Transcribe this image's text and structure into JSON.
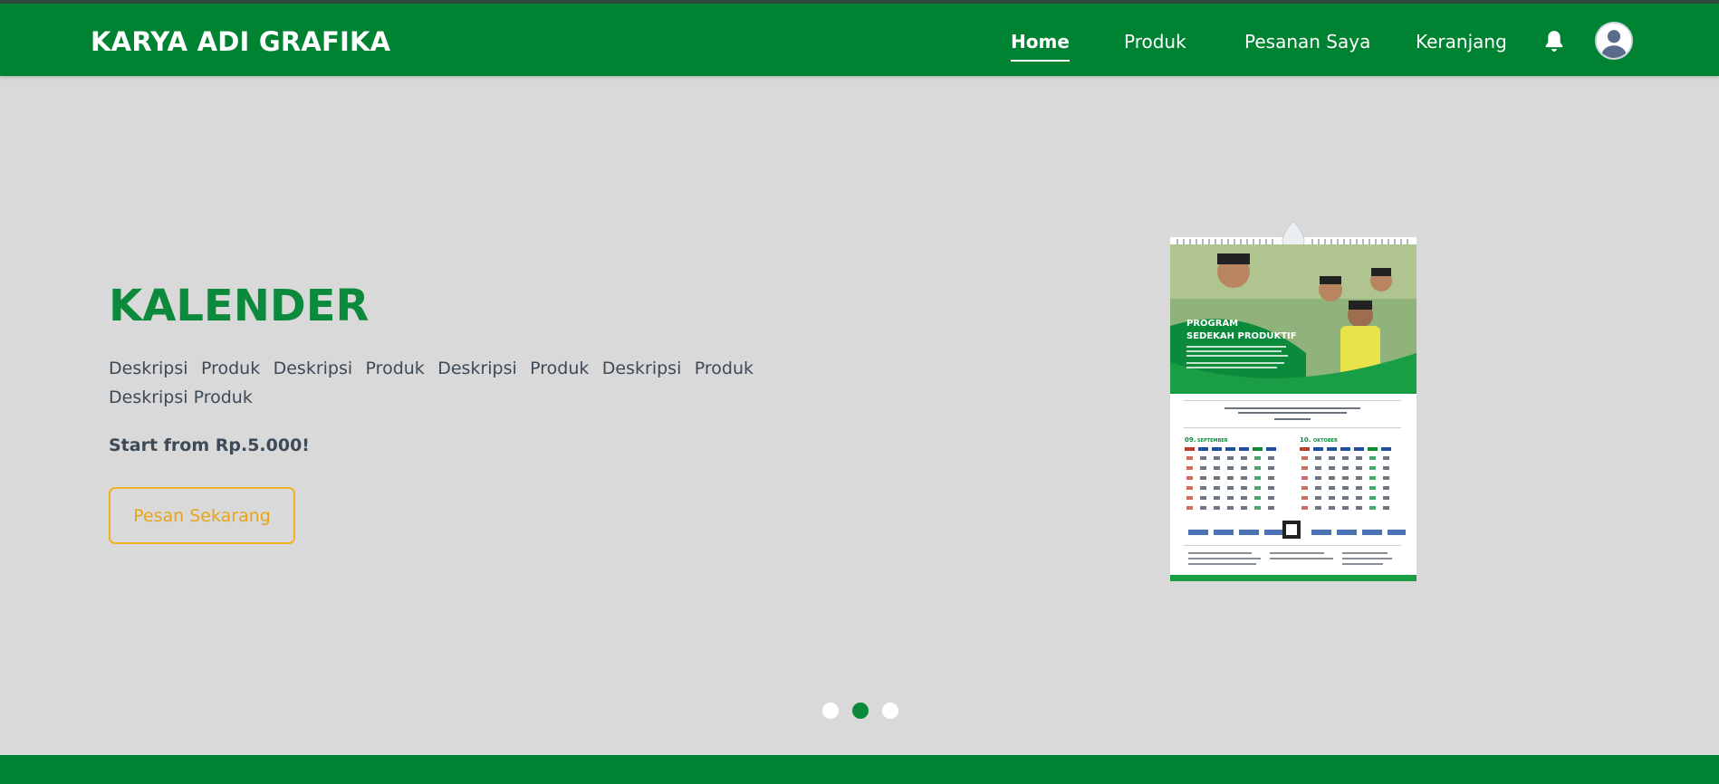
{
  "brand": "KARYA ADI GRAFIKA",
  "nav": {
    "items": [
      {
        "label": "Home",
        "active": true
      },
      {
        "label": "Produk",
        "active": false
      },
      {
        "label": "Pesanan Saya",
        "active": false
      },
      {
        "label": "Keranjang",
        "active": false
      }
    ],
    "icons": [
      "bell-icon",
      "user-avatar-icon"
    ]
  },
  "hero": {
    "title": "KALENDER",
    "description": "Deskripsi Produk Deskripsi Produk Deskripsi Produk Deskripsi Produk Deskripsi Produk",
    "price": "Start from Rp.5.000!",
    "cta_label": "Pesan Sekarang"
  },
  "calendar_image": {
    "heading_line1": "PROGRAM",
    "heading_line2": "SEDEKAH PRODUKTIF",
    "month1_label": "09.",
    "month1_name": "SEPTEMBER",
    "month2_label": "10.",
    "month2_name": "OKTOBER"
  },
  "carousel": {
    "slides": 3,
    "active_index": 1
  },
  "colors": {
    "brand_green": "#008233",
    "title_green": "#0a8a3a",
    "cta_orange": "#e8a317",
    "hero_bg": "#d9d9d9"
  }
}
